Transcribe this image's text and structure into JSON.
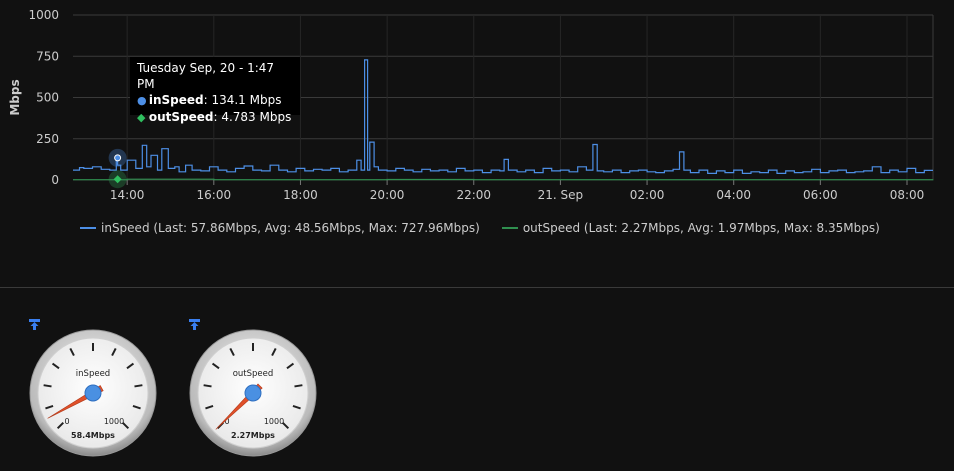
{
  "chart_data": {
    "type": "line",
    "ylabel": "Mbps",
    "ylim": [
      0,
      1000
    ],
    "yticks": [
      "0",
      "250",
      "500",
      "750",
      "1000"
    ],
    "yticks_values": [
      0,
      250,
      500,
      750,
      1000
    ],
    "xticks": [
      "14:00",
      "16:00",
      "18:00",
      "20:00",
      "22:00",
      "21. Sep",
      "02:00",
      "04:00",
      "06:00",
      "08:00"
    ],
    "xticks_hours": [
      14,
      16,
      18,
      20,
      22,
      24,
      26,
      28,
      30,
      32
    ],
    "xlim_hours": [
      12.75,
      32.6
    ],
    "grid": true,
    "legend_position": "bottom",
    "series": [
      {
        "name": "inSpeed",
        "color": "#4d8fe6",
        "legend": "inSpeed (Last: 57.86Mbps, Avg: 48.56Mbps, Max: 727.96Mbps)",
        "x_hours": [
          12.75,
          12.9,
          13.0,
          13.2,
          13.4,
          13.6,
          13.75,
          13.78,
          13.85,
          14.0,
          14.2,
          14.35,
          14.45,
          14.55,
          14.7,
          14.8,
          14.95,
          15.1,
          15.2,
          15.35,
          15.5,
          15.7,
          15.9,
          16.1,
          16.3,
          16.5,
          16.7,
          16.9,
          17.1,
          17.3,
          17.5,
          17.7,
          17.9,
          18.1,
          18.3,
          18.5,
          18.7,
          18.9,
          19.1,
          19.3,
          19.4,
          19.48,
          19.55,
          19.6,
          19.7,
          19.8,
          20.0,
          20.2,
          20.4,
          20.6,
          20.8,
          21.0,
          21.2,
          21.4,
          21.6,
          21.8,
          22.0,
          22.2,
          22.4,
          22.6,
          22.7,
          22.8,
          23.0,
          23.2,
          23.4,
          23.6,
          23.8,
          24.0,
          24.2,
          24.4,
          24.6,
          24.75,
          24.85,
          25.0,
          25.2,
          25.4,
          25.6,
          25.8,
          26.0,
          26.2,
          26.4,
          26.6,
          26.75,
          26.85,
          27.0,
          27.2,
          27.4,
          27.6,
          27.8,
          28.0,
          28.2,
          28.4,
          28.6,
          28.8,
          29.0,
          29.2,
          29.4,
          29.6,
          29.8,
          30.0,
          30.2,
          30.4,
          30.6,
          30.8,
          31.0,
          31.2,
          31.4,
          31.6,
          31.8,
          32.0,
          32.2,
          32.4,
          32.6
        ],
        "values": [
          60,
          75,
          70,
          80,
          65,
          60,
          134,
          90,
          60,
          120,
          70,
          210,
          80,
          150,
          60,
          190,
          70,
          80,
          50,
          90,
          60,
          55,
          80,
          60,
          50,
          70,
          85,
          60,
          55,
          90,
          60,
          50,
          70,
          55,
          65,
          60,
          70,
          50,
          60,
          120,
          60,
          728,
          60,
          230,
          80,
          60,
          55,
          70,
          60,
          50,
          65,
          55,
          60,
          50,
          70,
          55,
          60,
          45,
          60,
          55,
          125,
          60,
          50,
          60,
          45,
          70,
          55,
          60,
          50,
          80,
          60,
          215,
          55,
          50,
          60,
          45,
          55,
          60,
          50,
          45,
          55,
          65,
          170,
          60,
          45,
          60,
          40,
          55,
          45,
          60,
          40,
          50,
          45,
          60,
          40,
          55,
          45,
          50,
          65,
          45,
          55,
          60,
          45,
          50,
          55,
          80,
          45,
          60,
          50,
          70,
          45,
          58
        ],
        "tooltip_value": "134.1 Mbps"
      },
      {
        "name": "outSpeed",
        "color": "#2f8f4f",
        "legend": "outSpeed (Last: 2.27Mbps, Avg: 1.97Mbps, Max: 8.35Mbps)",
        "x_hours": [
          12.75,
          14.0,
          16.0,
          18.0,
          20.0,
          22.0,
          24.0,
          26.0,
          28.0,
          30.0,
          32.6
        ],
        "values": [
          2,
          4.8,
          2,
          2,
          3,
          2,
          2,
          2,
          2,
          2,
          2.27
        ],
        "tooltip_value": "4.783 Mbps"
      }
    ],
    "tooltip": {
      "title": "Tuesday Sep, 20 - 1:47 PM",
      "hour": 13.78
    }
  },
  "gauges": [
    {
      "name": "inSpeed",
      "min_label": "0",
      "max_label": "1000",
      "value": 58.4,
      "max": 1000,
      "reading": "58.4Mbps"
    },
    {
      "name": "outSpeed",
      "min_label": "0",
      "max_label": "1000",
      "value": 2.27,
      "max": 1000,
      "reading": "2.27Mbps"
    }
  ],
  "colors": {
    "background": "#111111",
    "grid": "#3a3a3a",
    "needle": "#e0502a",
    "gauge_hub": "#4a90e2",
    "pin": "#3a7ff0"
  },
  "icons": {
    "gauge_pin": "pin-icon"
  }
}
